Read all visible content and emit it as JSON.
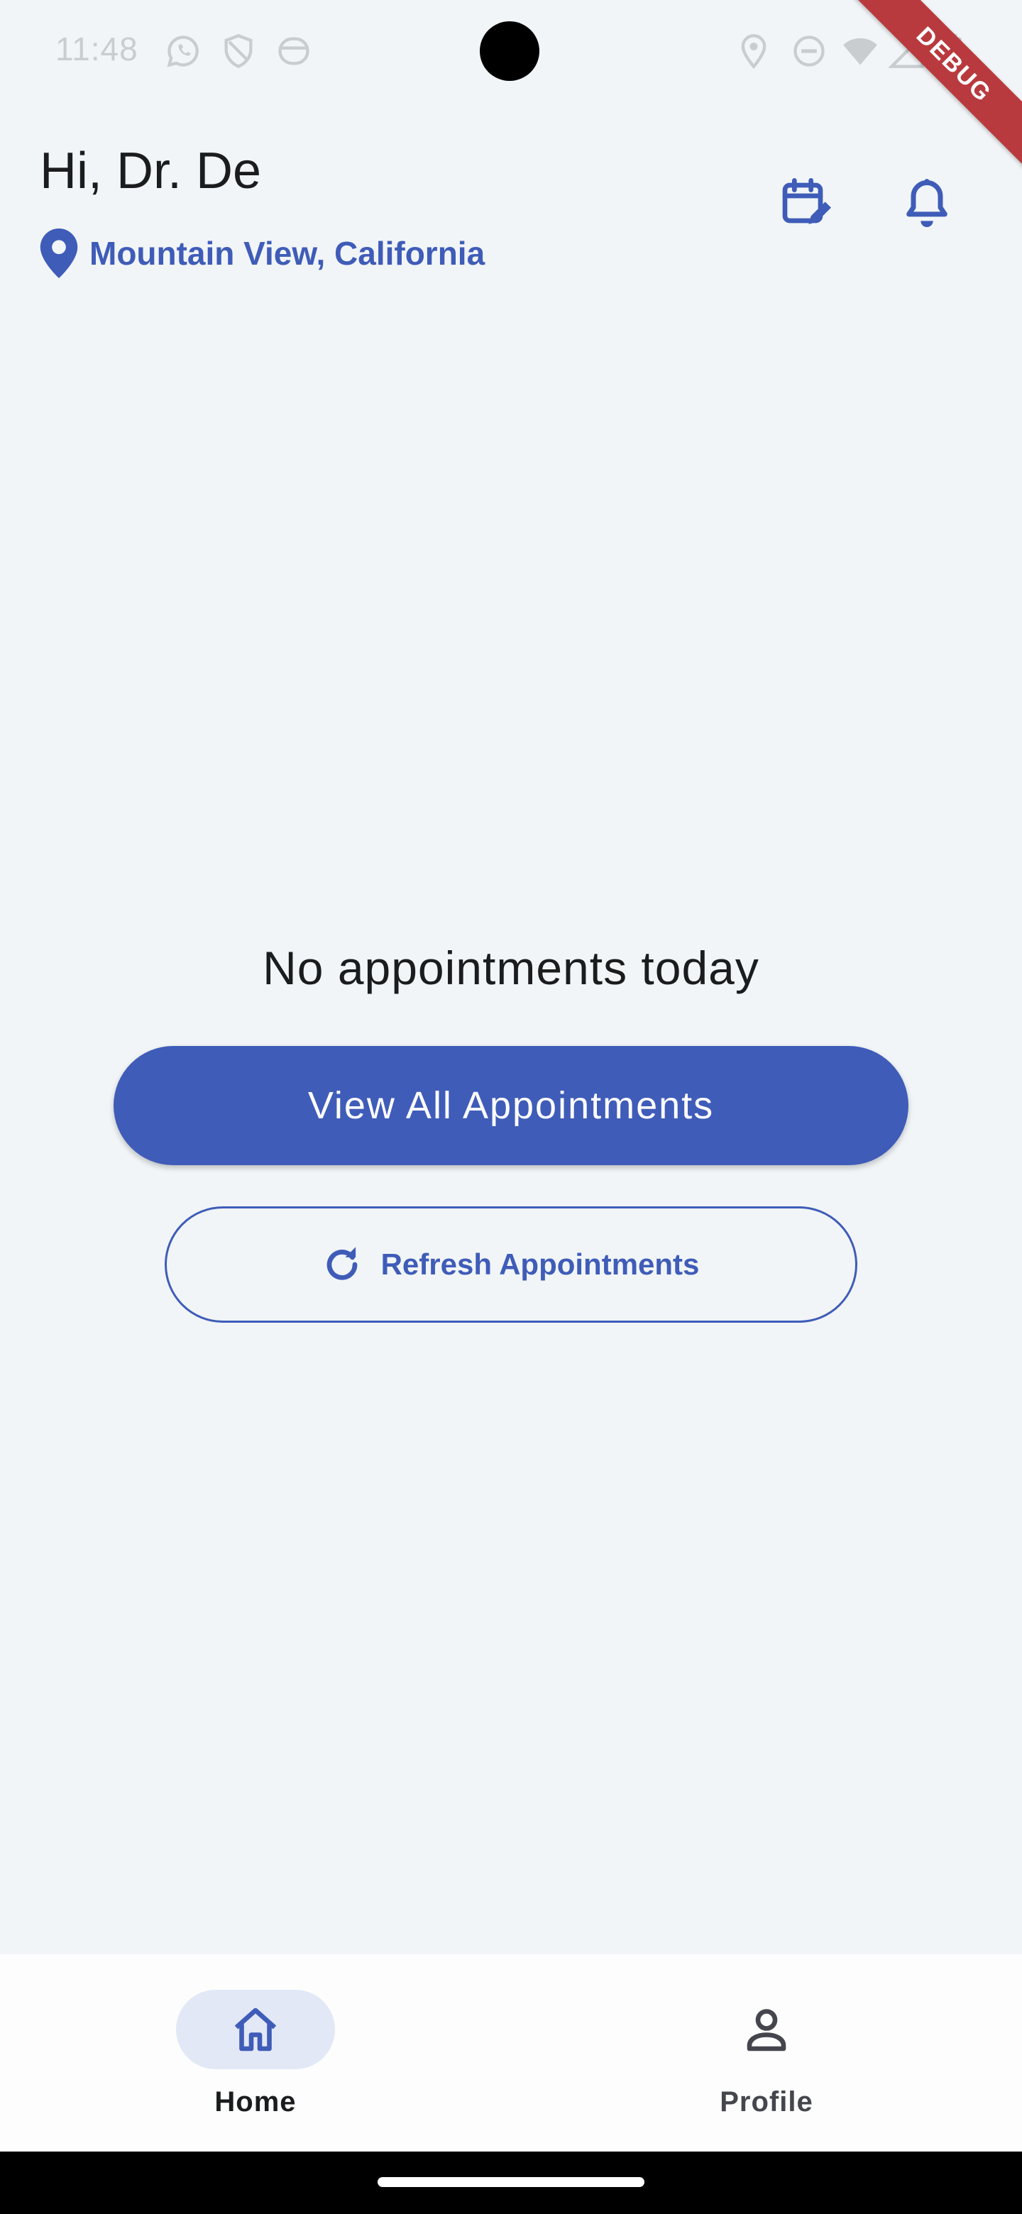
{
  "status_bar": {
    "time": "11:48",
    "left_icons": [
      "whatsapp-icon",
      "shield-icon",
      "app-icon"
    ],
    "right_icons": [
      "location-icon",
      "dnd-icon",
      "wifi-icon",
      "signal-icon",
      "battery-icon"
    ]
  },
  "debug_banner": {
    "label": "DEBUG"
  },
  "header": {
    "greeting": "Hi, Dr. De",
    "location": "Mountain View, California",
    "actions": [
      "calendar-edit-icon",
      "bell-icon"
    ]
  },
  "main": {
    "empty_message": "No appointments today",
    "primary_button": "View All Appointments",
    "secondary_button": "Refresh Appointments"
  },
  "bottom_nav": {
    "items": [
      {
        "label": "Home",
        "icon": "home-icon",
        "selected": true
      },
      {
        "label": "Profile",
        "icon": "person-icon",
        "selected": false
      }
    ]
  },
  "colors": {
    "accent": "#3f5cb8",
    "background": "#f1f5f7",
    "nav_background": "#fdfdfd",
    "nav_indicator": "#e2e8f6",
    "debug_ribbon": "#b93a3e",
    "text_primary": "#1b1c1e"
  }
}
